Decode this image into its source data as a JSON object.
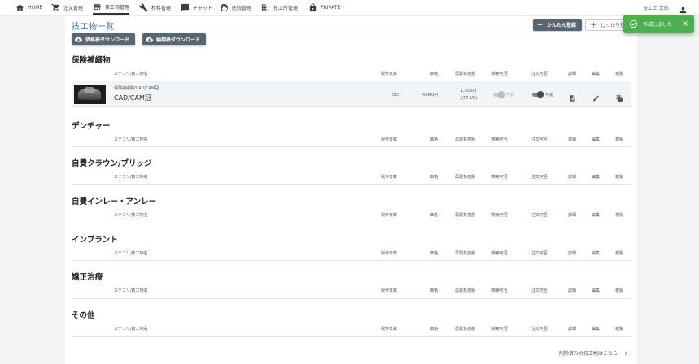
{
  "nav": {
    "items": [
      {
        "label": "HOME",
        "icon": "home-icon"
      },
      {
        "label": "注文管理",
        "icon": "cart-icon"
      },
      {
        "label": "技工物管理",
        "icon": "store-icon"
      },
      {
        "label": "材料管理",
        "icon": "wrench-icon"
      },
      {
        "label": "チャット",
        "icon": "chat-icon"
      },
      {
        "label": "医院管理",
        "icon": "face-icon"
      },
      {
        "label": "技工所管理",
        "icon": "building-icon"
      },
      {
        "label": "PRIVATE",
        "icon": "lock-icon"
      }
    ],
    "user_name": "技工士 太郎",
    "user_icon": "person-icon"
  },
  "page": {
    "title": "技工物一覧",
    "quick_register": "かんたん登録",
    "full_register": "しっかり登録",
    "price_download": "価格表ダウンロード",
    "delivery_download": "納期表ダウンロード",
    "deleted_link": "削除済みの技工物はこちら"
  },
  "columns": {
    "name": "カテゴリ/技工物名",
    "days": "製作日数",
    "price": "価格",
    "remake_share": "再製負担額",
    "search": "検索可否",
    "order": "注文可否",
    "detail": "詳細",
    "edit": "編集",
    "copy": "複製"
  },
  "sections": [
    {
      "title": "保険補綴物"
    },
    {
      "title": "デンチャー"
    },
    {
      "title": "自費クラウン/ブリッジ"
    },
    {
      "title": "自費インレー・アンレー"
    },
    {
      "title": "インプラント"
    },
    {
      "title": "矯正治療"
    },
    {
      "title": "その他"
    }
  ],
  "product": {
    "category": "保険補綴物/CAD/CAM冠",
    "name": "CAD/CAM冠",
    "days": "5日",
    "price": "4,000円",
    "remake_amount": "1,500円",
    "remake_percent": "(37.5%)",
    "search_label": "可能",
    "search_enabled": false,
    "order_label": "可能",
    "order_enabled": true
  },
  "toast": {
    "message": "作成しました",
    "color": "#4caf50"
  },
  "colors": {
    "accent": "#3f6fa6",
    "button_dark": "#5a6570"
  }
}
